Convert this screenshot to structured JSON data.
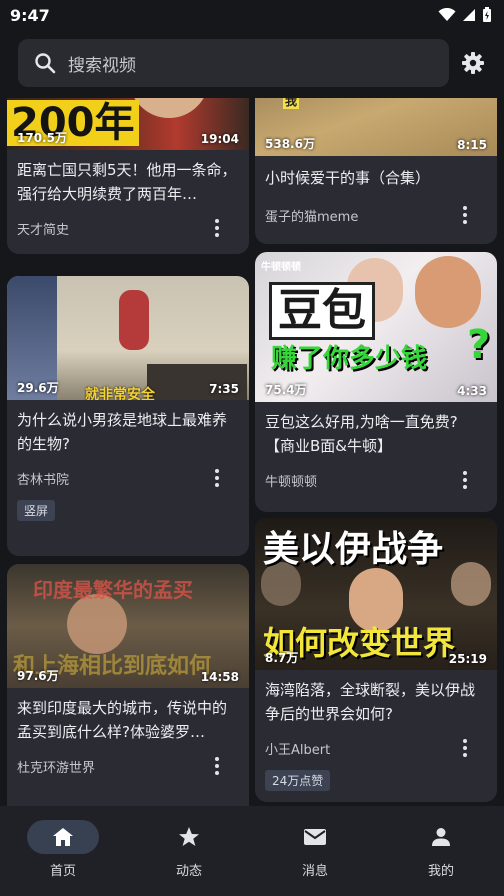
{
  "status": {
    "time": "9:47"
  },
  "search": {
    "placeholder": "搜索视频"
  },
  "cards": [
    {
      "overlay": "200年",
      "stat": "170.5万",
      "duration": "19:04",
      "title": "距离亡国只剩5天！他用一条命，强行给大明续费了两百年…",
      "author": "天才简史"
    },
    {
      "overlay": "我",
      "stat": "538.6万",
      "duration": "8:15",
      "title": "小时候爱干的事（合集）",
      "author": "蛋子的猫meme"
    },
    {
      "overlay": "就非常安全",
      "stat": "29.6万",
      "duration": "7:35",
      "title": "为什么说小男孩是地球上最难养的生物?",
      "author": "杏林书院",
      "badge": "竖屏"
    },
    {
      "channel_mark": "牛顿顿顿",
      "overlay1": "豆包",
      "overlay2": "赚了你多少钱",
      "overlay3": "?",
      "stat": "75.4万",
      "duration": "4:33",
      "title": "豆包这么好用,为啥一直免费?【商业B面&牛顿】",
      "author": "牛顿顿顿"
    },
    {
      "overlay1": "印度最繁华的孟买",
      "overlay2": "和上海相比到底如何",
      "stat": "97.6万",
      "duration": "14:58",
      "title": "来到印度最大的城市，传说中的孟买到底什么样?体验婆罗…",
      "author": "杜克环游世界"
    },
    {
      "overlay1": "美以伊战争",
      "overlay2": "如何改变世界",
      "stat": "8.7万",
      "duration": "25:19",
      "title": "海湾陷落，全球断裂，美以伊战争后的世界会如何?",
      "author": "小王Albert",
      "badge": "24万点赞"
    }
  ],
  "nav": [
    {
      "label": "首页",
      "icon": "home-icon"
    },
    {
      "label": "动态",
      "icon": "star-icon"
    },
    {
      "label": "消息",
      "icon": "mail-icon"
    },
    {
      "label": "我的",
      "icon": "person-icon"
    }
  ]
}
